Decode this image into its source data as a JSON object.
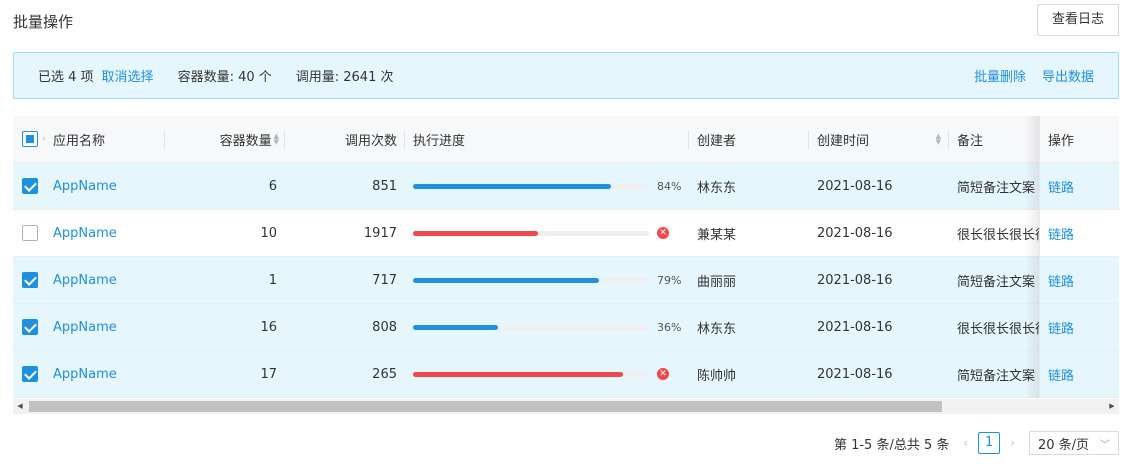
{
  "page": {
    "title": "批量操作",
    "log_button": "查看日志"
  },
  "selection": {
    "selected_text": "已选 4 项",
    "cancel_label": "取消选择",
    "container_count": "容器数量: 40 个",
    "call_volume": "调用量: 2641 次",
    "batch_delete": "批量删除",
    "export": "导出数据"
  },
  "table": {
    "columns": {
      "app_name": "应用名称",
      "container_count": "容器数量",
      "call_count": "调用次数",
      "progress": "执行进度",
      "creator": "创建者",
      "created_at": "创建时间",
      "note": "备注",
      "action": "操作"
    },
    "rows": [
      {
        "checked": true,
        "app": "AppName",
        "containers": "6",
        "calls": "851",
        "progress": 0.84,
        "status": "normal",
        "pct_label": "84%",
        "creator": "林东东",
        "date": "2021-08-16",
        "note": "简短备注文案",
        "action": "链路"
      },
      {
        "checked": false,
        "app": "AppName",
        "containers": "10",
        "calls": "1917",
        "progress": 0.53,
        "status": "error",
        "pct_label": "",
        "creator": "兼某某",
        "date": "2021-08-16",
        "note": "很长很长很长很长",
        "action": "链路"
      },
      {
        "checked": true,
        "app": "AppName",
        "containers": "1",
        "calls": "717",
        "progress": 0.79,
        "status": "normal",
        "pct_label": "79%",
        "creator": "曲丽丽",
        "date": "2021-08-16",
        "note": "简短备注文案",
        "action": "链路"
      },
      {
        "checked": true,
        "app": "AppName",
        "containers": "16",
        "calls": "808",
        "progress": 0.36,
        "status": "normal",
        "pct_label": "36%",
        "creator": "林东东",
        "date": "2021-08-16",
        "note": "很长很长很长很长",
        "action": "链路"
      },
      {
        "checked": true,
        "app": "AppName",
        "containers": "17",
        "calls": "265",
        "progress": 0.89,
        "status": "error",
        "pct_label": "",
        "creator": "陈帅帅",
        "date": "2021-08-16",
        "note": "简短备注文案",
        "action": "链路"
      }
    ]
  },
  "pagination": {
    "summary": "第 1-5 条/总共 5 条",
    "current_page": "1",
    "page_size": "20 条/页"
  },
  "colors": {
    "primary": "#1f8fe0",
    "error": "#f0484d",
    "selected_row_bg": "#e6f6fd"
  }
}
